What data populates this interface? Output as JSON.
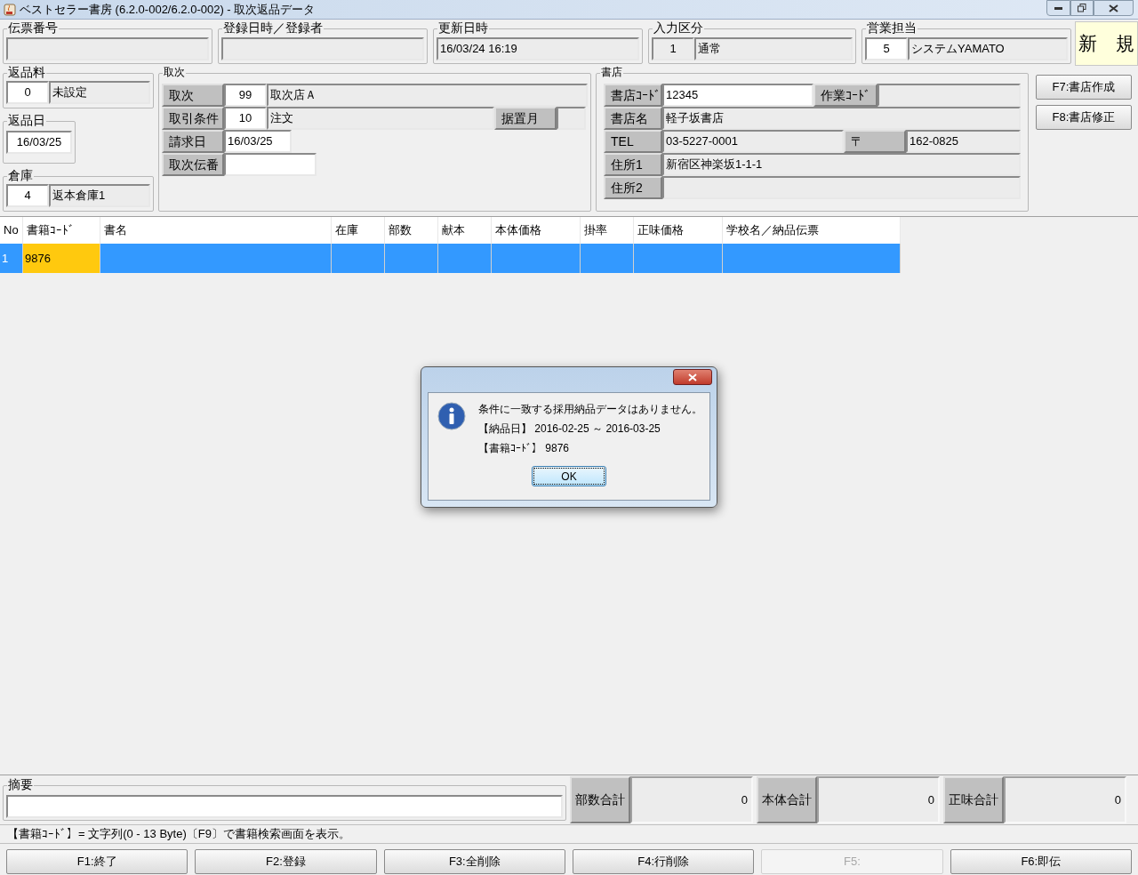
{
  "window": {
    "title": "ベストセラー書房 (6.2.0-002/6.2.0-002) - 取次返品データ"
  },
  "header_fields": [
    {
      "label": "伝票番号"
    },
    {
      "label": "登録日時／登録者"
    },
    {
      "label": "更新日時",
      "value": "16/03/24 16:19"
    },
    {
      "label": "入力区分",
      "code": "1",
      "code_editable": false,
      "value": "通常"
    },
    {
      "label": "営業担当",
      "code": "5",
      "code_editable": true,
      "value": "システムYAMATO"
    }
  ],
  "mode_badge": "新　規",
  "return_fee": {
    "label": "返品料",
    "code": "0",
    "value": "未設定"
  },
  "return_date": {
    "label": "返品日",
    "value": "16/03/25"
  },
  "warehouse": {
    "label": "倉庫",
    "code": "4",
    "value": "返本倉庫1"
  },
  "distributor": {
    "title": "取次",
    "rows": [
      {
        "label": "取次",
        "code": "99",
        "value": "取次店Ａ"
      },
      {
        "label": "取引条件",
        "code": "10",
        "value": "注文",
        "extra_label": "据置月"
      },
      {
        "label": "請求日",
        "code": "16/03/25"
      },
      {
        "label": "取次伝番"
      }
    ]
  },
  "bookstore": {
    "title": "書店",
    "rows": [
      {
        "label": "書店ｺｰﾄﾞ",
        "value": "12345",
        "value_editable": true,
        "extra_label": "作業ｺｰﾄﾞ"
      },
      {
        "label": "書店名",
        "value": "軽子坂書店"
      },
      {
        "label": "TEL",
        "value": "03-5227-0001",
        "extra_label": "〒",
        "extra_value": "162-0825"
      },
      {
        "label": "住所1",
        "value": "新宿区神楽坂1-1-1"
      },
      {
        "label": "住所2"
      }
    ]
  },
  "side_buttons": [
    "F7:書店作成",
    "F8:書店修正"
  ],
  "table": {
    "columns": [
      "No",
      "書籍ｺｰﾄﾞ",
      "書名",
      "在庫",
      "部数",
      "献本",
      "本体価格",
      "掛率",
      "正味価格",
      "学校名／納品伝票"
    ],
    "rows": [
      {
        "selected": true,
        "cells": [
          {
            "text": "1",
            "focused": false
          },
          {
            "text": "9876",
            "focused": true
          },
          {
            "focused": false
          },
          {
            "focused": false
          },
          {
            "focused": false
          },
          {
            "focused": false
          },
          {
            "focused": false
          },
          {
            "focused": false
          },
          {
            "focused": false
          },
          {
            "focused": false
          }
        ]
      }
    ]
  },
  "memo": {
    "label": "摘要"
  },
  "totals": [
    {
      "label": "部数合計",
      "value": "0"
    },
    {
      "label": "本体合計",
      "value": "0"
    },
    {
      "label": "正味合計",
      "value": "0"
    }
  ],
  "hint": "【書籍ｺｰﾄﾞ】= 文字列(0 - 13 Byte)〔F9〕で書籍検索画面を表示。",
  "function_keys": [
    {
      "label": "F1:終了",
      "disabled": false
    },
    {
      "label": "F2:登録",
      "disabled": false
    },
    {
      "label": "F3:全削除",
      "disabled": false
    },
    {
      "label": "F4:行削除",
      "disabled": false
    },
    {
      "label": "F5:",
      "disabled": true
    },
    {
      "label": "F6:即伝",
      "disabled": false
    }
  ],
  "dialog": {
    "lines": [
      "条件に一致する採用納品データはありません。",
      "【納品日】 2016-02-25 ～ 2016-03-25",
      "【書籍ｺｰﾄﾞ】 9876"
    ],
    "button": "OK"
  }
}
